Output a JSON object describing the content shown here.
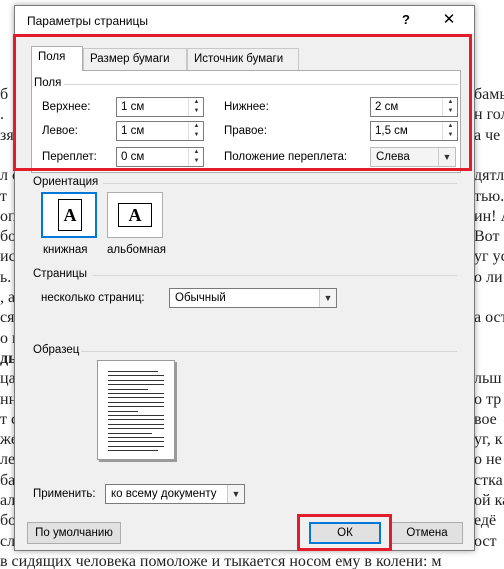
{
  "background_text": [
    {
      "text": "б",
      "cont": "бамы"
    },
    {
      "text": ".",
      "cont": "н гол"
    },
    {
      "text": "зя",
      "cont": "а че"
    },
    {
      "text": "",
      "cont": ""
    },
    {
      "text": "л с",
      "cont": "дятл"
    },
    {
      "text": "т",
      "cont": "тью."
    },
    {
      "text": "оп",
      "cont": "ин! А"
    },
    {
      "text": "бор",
      "cont": "Вот"
    },
    {
      "text": "ис",
      "cont": "уг ус"
    },
    {
      "text": "ь. С",
      "cont": "о ли"
    },
    {
      "text": ", а",
      "cont": ""
    },
    {
      "text": "ся.",
      "cont": "а ост"
    },
    {
      "text": "о н",
      "cont": ""
    },
    {
      "text": "дь",
      "cont": ""
    },
    {
      "text": "ца",
      "cont": "льш"
    },
    {
      "text": "нн",
      "cont": "о тр"
    },
    {
      "text": "т с",
      "cont": "вое"
    },
    {
      "text": "же",
      "cont": "уг, к"
    },
    {
      "text": "ле",
      "cont": "о не"
    },
    {
      "text": "ба",
      "cont": "стка"
    },
    {
      "text": "ал",
      "cont": "ой ка"
    },
    {
      "text": "бо",
      "cont": "едё"
    },
    {
      "text": "сл",
      "cont": "ост"
    },
    {
      "text": "в сидящих человека помоложе и тыкается носом ему в колени: м",
      "cont": ""
    }
  ],
  "dialog": {
    "title": "Параметры страницы",
    "help_label": "?",
    "close_label": "✕",
    "tabs": [
      {
        "label": "Поля",
        "active": true
      },
      {
        "label": "Размер бумаги",
        "active": false
      },
      {
        "label": "Источник бумаги",
        "active": false
      }
    ],
    "margins": {
      "group_label": "Поля",
      "top": {
        "label": "Верхнее:",
        "value": "1 см"
      },
      "bottom": {
        "label": "Нижнее:",
        "value": "2 см"
      },
      "left": {
        "label": "Левое:",
        "value": "1 см"
      },
      "right": {
        "label": "Правое:",
        "value": "1,5 см"
      },
      "gutter": {
        "label": "Переплет:",
        "value": "0 см"
      },
      "gutter_position": {
        "label": "Положение переплета:",
        "value": "Слева"
      }
    },
    "orientation": {
      "group_label": "Ориентация",
      "portrait_label": "книжная",
      "landscape_label": "альбомная",
      "icon_letter": "A",
      "selected": "portrait"
    },
    "pages": {
      "group_label": "Страницы",
      "multiple_label": "несколько страниц:",
      "multiple_value": "Обычный"
    },
    "preview": {
      "group_label": "Образец"
    },
    "apply": {
      "label": "Применить:",
      "value": "ко всему документу"
    },
    "buttons": {
      "default_label": "По умолчанию",
      "ok_label": "ОК",
      "cancel_label": "Отмена"
    }
  },
  "colors": {
    "highlight_box": "#e21c2a",
    "focus_blue": "#0078d7"
  }
}
